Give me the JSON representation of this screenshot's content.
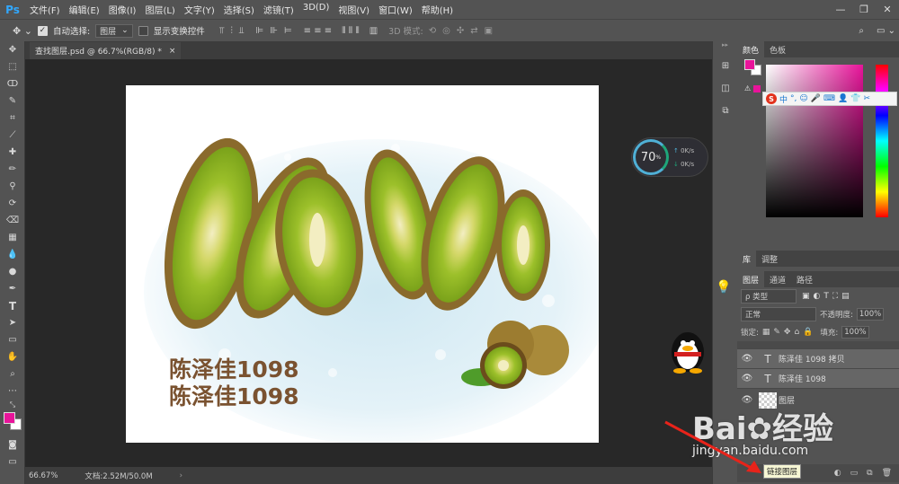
{
  "app": {
    "logo": "Ps"
  },
  "menubar": {
    "items": [
      "文件(F)",
      "编辑(E)",
      "图像(I)",
      "图层(L)",
      "文字(Y)",
      "选择(S)",
      "滤镜(T)",
      "3D(D)",
      "视图(V)",
      "窗口(W)",
      "帮助(H)"
    ]
  },
  "options": {
    "auto_select_label": "自动选择:",
    "auto_select_value": "图层",
    "show_transform_label": "显示变换控件",
    "mode_3d_label": "3D 模式:"
  },
  "document": {
    "tab_title": "查找图层.psd @ 66.7%(RGB/8) *",
    "close": "×"
  },
  "canvas": {
    "text_line1": "陈泽佳1098",
    "text_line2": "陈泽佳1098"
  },
  "status": {
    "zoom": "66.67%",
    "doc_info": "文档:2.52M/50.0M"
  },
  "netmeter": {
    "percent": "70",
    "unit": "%",
    "up": "0K/s",
    "down": "0K/s"
  },
  "panels": {
    "color_tabs": [
      "颜色",
      "色板"
    ],
    "lib_tabs": [
      "库",
      "调整"
    ],
    "layers_tabs": [
      "图层",
      "通道",
      "路径"
    ],
    "kind_label": "ρ 类型",
    "blend_mode": "正常",
    "opacity_label": "不透明度:",
    "opacity_value": "100%",
    "lock_label": "锁定:",
    "fill_label": "填充:",
    "fill_value": "100%",
    "layers": [
      {
        "name": "陈泽佳 1098 拷贝"
      },
      {
        "name": "陈泽佳 1098"
      },
      {
        "name": "图层"
      }
    ],
    "tooltip": "链接图层"
  },
  "ime": {
    "items": [
      "中",
      "°,",
      "☺",
      "🎤",
      "⌨",
      "👤",
      "👕",
      "✂"
    ]
  },
  "watermark": {
    "brand_a": "Bai",
    "brand_b": "经验",
    "url": "jingyan.baidu.com"
  },
  "colors": {
    "foreground": "#e8149a",
    "background": "#ffffff",
    "accent": "#31a8ff"
  }
}
